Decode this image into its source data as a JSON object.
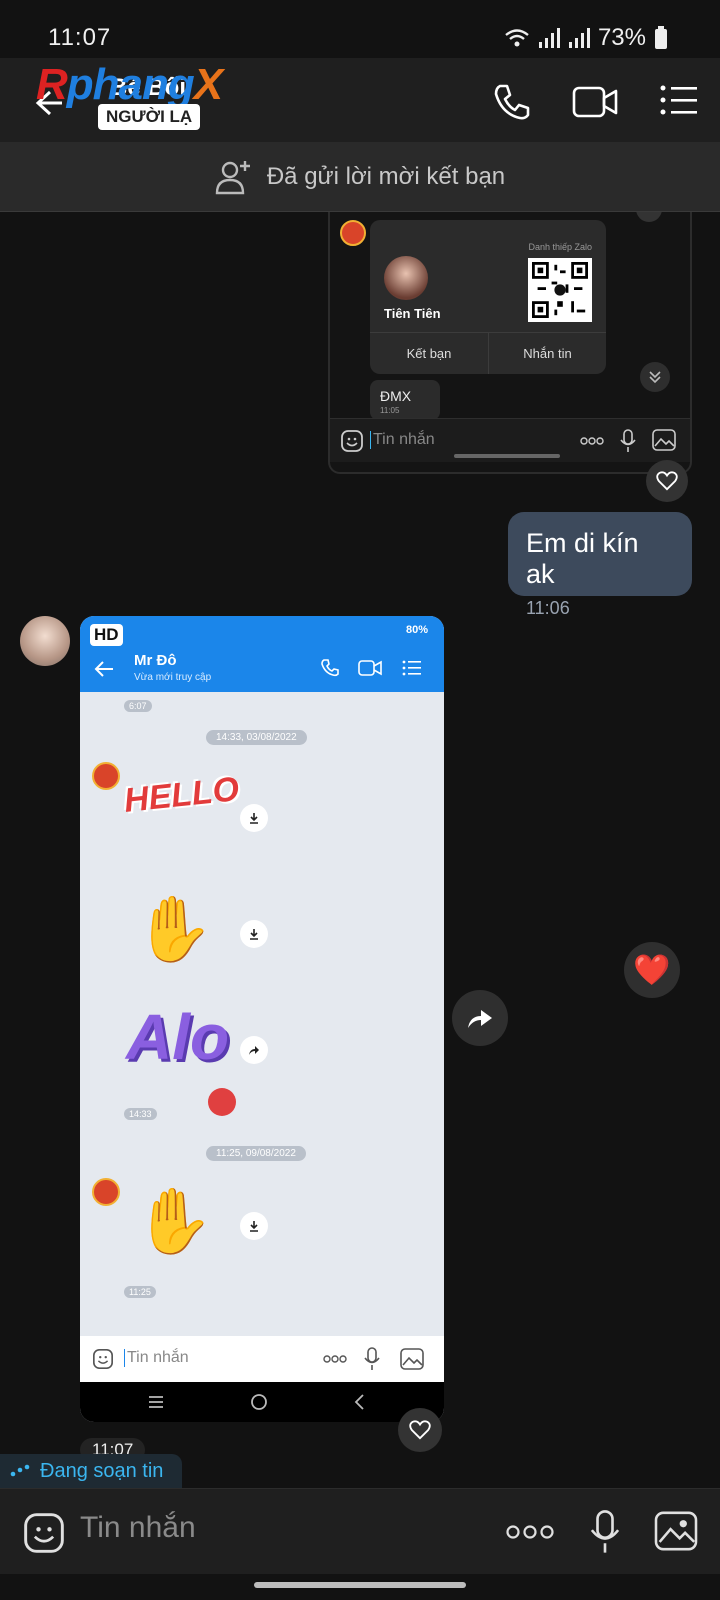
{
  "status_bar": {
    "time": "11:07",
    "battery": "73%"
  },
  "header": {
    "logo_part1": "R",
    "logo_part2": "phang",
    "logo_part3": "X",
    "contact_name": "Bé Bối",
    "stranger_badge": "NGƯỜI LẠ",
    "icons": [
      "back-icon",
      "phone-icon",
      "video-call-icon",
      "menu-icon"
    ]
  },
  "friend_banner": {
    "text": "Đã gửi lời mời kết bạn"
  },
  "shot1": {
    "card_caption": "Danh thiếp Zalo",
    "card_name": "Tiên Tiên",
    "btn_add_friend": "Kết bạn",
    "btn_message": "Nhắn tin",
    "msg_text": "ĐMX",
    "msg_time": "11:05",
    "input_placeholder": "Tin nhắn"
  },
  "my_message": {
    "text": "Em di kín ak",
    "time": "11:06"
  },
  "shot2": {
    "hd_badge": "HD",
    "status_battery": "80%",
    "chat_name": "Mr Đô",
    "chat_status": "Vừa mới truy cập",
    "time_top": "6:07",
    "date_pill1": "14:33, 03/08/2022",
    "sticker_hello": "HELLO",
    "sticker_alo": "Alo",
    "time_mid": "14:33",
    "date_pill2": "11:25, 09/08/2022",
    "time_bottom": "11:25",
    "input_placeholder": "Tin nhắn"
  },
  "reactions": {
    "heart_emoji": "❤️"
  },
  "last_time": "11:07",
  "typing": {
    "text": "Đang soạn tin"
  },
  "input": {
    "placeholder": "Tin nhắn"
  },
  "colors": {
    "accent": "#3bb6f0",
    "bubble_mine": "#3d4a5c",
    "zalo_blue": "#1b86ea",
    "heart": "#e0102a"
  }
}
